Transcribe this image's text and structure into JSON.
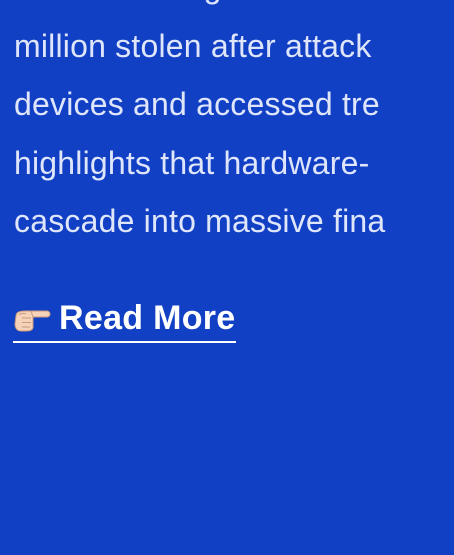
{
  "article": {
    "lines": [
      "one of the largest ...",
      "million stolen after attack",
      "devices and accessed tre",
      "highlights that hardware-",
      "cascade into massive fina"
    ]
  },
  "read_more": {
    "icon": "pointing-hand-right-icon",
    "label": "Read More"
  },
  "colors": {
    "background": "#1140c4",
    "text": "#dfe6fb",
    "link": "#ffffff"
  }
}
